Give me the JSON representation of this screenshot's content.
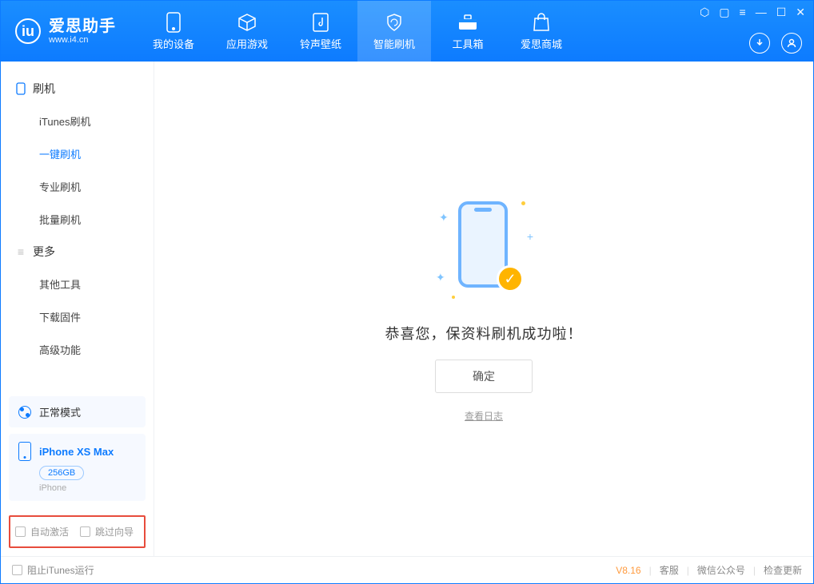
{
  "brand": {
    "name": "爱思助手",
    "url": "www.i4.cn"
  },
  "nav": {
    "tabs": [
      {
        "label": "我的设备"
      },
      {
        "label": "应用游戏"
      },
      {
        "label": "铃声壁纸"
      },
      {
        "label": "智能刷机"
      },
      {
        "label": "工具箱"
      },
      {
        "label": "爱思商城"
      }
    ],
    "active_index": 3
  },
  "sidebar": {
    "groups": [
      {
        "title": "刷机",
        "items": [
          {
            "label": "iTunes刷机"
          },
          {
            "label": "一键刷机"
          },
          {
            "label": "专业刷机"
          },
          {
            "label": "批量刷机"
          }
        ],
        "active_index": 1
      },
      {
        "title": "更多",
        "items": [
          {
            "label": "其他工具"
          },
          {
            "label": "下载固件"
          },
          {
            "label": "高级功能"
          }
        ],
        "active_index": -1
      }
    ]
  },
  "device": {
    "mode_label": "正常模式",
    "name": "iPhone XS Max",
    "storage": "256GB",
    "type": "iPhone"
  },
  "options": {
    "auto_activate": "自动激活",
    "skip_guide": "跳过向导"
  },
  "main": {
    "success_msg": "恭喜您，保资料刷机成功啦！",
    "ok_label": "确定",
    "log_link": "查看日志"
  },
  "status": {
    "block_itunes": "阻止iTunes运行",
    "version": "V8.16",
    "links": {
      "support": "客服",
      "wechat": "微信公众号",
      "update": "检查更新"
    }
  }
}
